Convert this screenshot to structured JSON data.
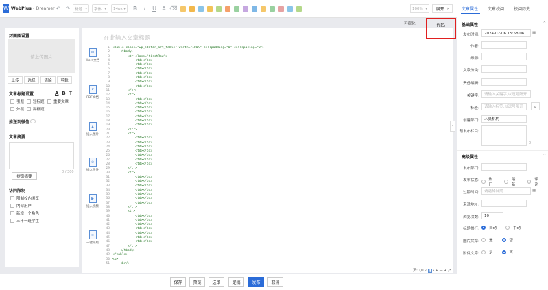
{
  "app": {
    "logo_mark": "W",
    "name": "WebPlus",
    "sub": "Dreamer"
  },
  "toolbar": {
    "style_select": "标题",
    "font_select": "字体",
    "size_select": "14px",
    "zoom": "100%",
    "expand": "展开",
    "icons": [
      "undo-icon",
      "redo-icon",
      "bold-icon",
      "italic-icon",
      "underline-icon",
      "strikethrough-icon"
    ],
    "icon_colors": [
      "#f5c76a",
      "#f2b84c",
      "#8bc5e8",
      "#f2c35a",
      "#b4d88a",
      "#f5a06a",
      "#9ad1a0",
      "#c6a8e0",
      "#7fb8e6",
      "#f5c76a",
      "#9ad1a0",
      "#e6a3a3",
      "#8bc5e8",
      "#b4d88a"
    ]
  },
  "cover": {
    "heading": "封面图设置",
    "upload": "请上传图片",
    "buttons": [
      "上传",
      "选择",
      "清除",
      "剪裁"
    ]
  },
  "title_settings": {
    "heading": "文章标题设置",
    "font_a": "A",
    "font_b": "B",
    "font_t": "T",
    "options": [
      "引题",
      "短标题",
      "重要文章",
      "外链",
      "副标题"
    ]
  },
  "wechat": {
    "label": "推送到微信"
  },
  "summary": {
    "heading": "文章摘要",
    "count": "0 / 300",
    "button": "提取摘要"
  },
  "access": {
    "heading": "访问限制",
    "options": [
      "限制校内浏览",
      "内部用户",
      "新增一个角色",
      "三年一班学生"
    ]
  },
  "editor": {
    "title_placeholder": "在此输入文章标题",
    "view_visual": "可视化",
    "view_code": "代码"
  },
  "insert_panel": [
    {
      "label": "Word文档",
      "icon": "W"
    },
    {
      "label": "PDF文档",
      "icon": "P"
    },
    {
      "label": "插入图片",
      "icon": "▲"
    },
    {
      "label": "插入附件",
      "icon": "⊕"
    },
    {
      "label": "插入视频",
      "icon": "▶"
    },
    {
      "label": "一键排版",
      "icon": "≡"
    }
  ],
  "code_lines": [
    "<table class=\"wp_editor_art_table\" width=\"100%\" cellpadding=\"0\" cellspacing=\"0\">",
    "    <tbody>",
    "        <tr class=\"firstRow\">",
    "            <td></td>",
    "            <td></td>",
    "            <td></td>",
    "            <td></td>",
    "            <td></td>",
    "            <td></td>",
    "            <td></td>",
    "        </tr>",
    "        <tr>",
    "            <td></td>",
    "            <td></td>",
    "            <td></td>",
    "            <td></td>",
    "            <td></td>",
    "            <td></td>",
    "            <td></td>",
    "        </tr>",
    "        <tr>",
    "            <td></td>",
    "            <td></td>",
    "            <td></td>",
    "            <td></td>",
    "            <td></td>",
    "            <td></td>",
    "            <td></td>",
    "        </tr>",
    "        <tr>",
    "            <td></td>",
    "            <td></td>",
    "            <td></td>",
    "            <td></td>",
    "            <td></td>",
    "            <td></td>",
    "            <td></td>",
    "        </tr>",
    "        <tr>",
    "            <td></td>",
    "            <td></td>",
    "            <td></td>",
    "            <td></td>",
    "            <td></td>",
    "            <td></td>",
    "            <td></td>",
    "        </tr>",
    "    </tbody>",
    "</table>",
    "<p>",
    "    <br/>",
    "</p>"
  ],
  "pager": {
    "text": "页: 1/1",
    "current": "1",
    "zoom_sep": "—"
  },
  "actions": [
    "保存",
    "预览",
    "送审",
    "定稿",
    "发布",
    "取消"
  ],
  "right": {
    "tabs": [
      "文章属性",
      "文章校阅",
      "校阅历史"
    ],
    "basic_heading": "基础属性",
    "publish_time_label": "发布时间:",
    "publish_time": "2024-02-06 15:58:06",
    "author_label": "作者:",
    "source_label": "来源:",
    "category_label": "文章分类:",
    "editor_label": "责任编辑:",
    "keywords_label": "关键字:",
    "keywords_ph": "请输入关键字,以逗号隔开",
    "tags_label": "标签:",
    "tags_ph": "请输入标签,以逗号隔开",
    "dept_label": "创建部门:",
    "dept": "人员机构",
    "column_label": "预发布栏目:",
    "column_count": "0",
    "advanced_heading": "高级属性",
    "adv_publish_label": "发布部门:",
    "status_label": "发布状态:",
    "status_opts": [
      "热门",
      "最新",
      "评论"
    ],
    "expire_label": "过期时间:",
    "expire_ph": "请选择日期",
    "source_url_label": "来源地址:",
    "views_label": "浏览次数:",
    "views": "10",
    "wrap_label": "标题换行:",
    "wrap_opts": [
      "自动",
      "手动"
    ],
    "img_label": "图片文章:",
    "img_opts": [
      "是",
      "否"
    ],
    "attach_label": "附件文章:",
    "attach_opts": [
      "是",
      "否"
    ]
  }
}
